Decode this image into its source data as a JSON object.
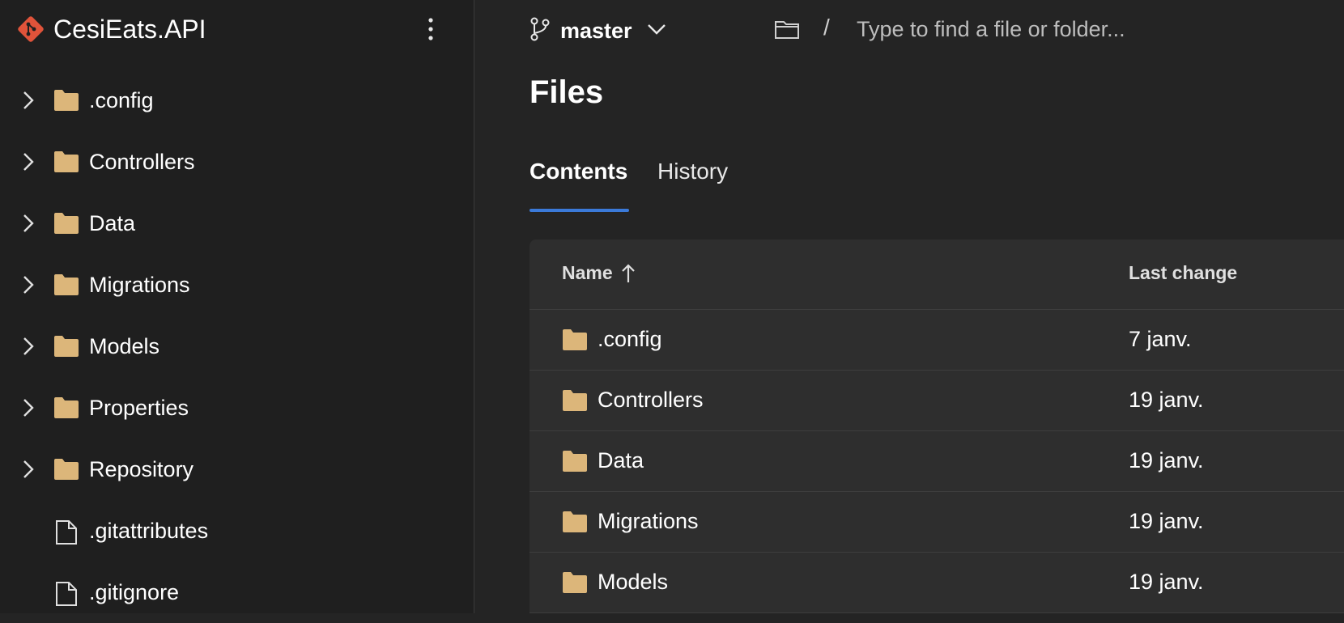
{
  "repo": {
    "name": "CesiEats.API"
  },
  "sidebar": {
    "items": [
      {
        "label": ".config",
        "type": "folder"
      },
      {
        "label": "Controllers",
        "type": "folder"
      },
      {
        "label": "Data",
        "type": "folder"
      },
      {
        "label": "Migrations",
        "type": "folder"
      },
      {
        "label": "Models",
        "type": "folder"
      },
      {
        "label": "Properties",
        "type": "folder"
      },
      {
        "label": "Repository",
        "type": "folder"
      },
      {
        "label": ".gitattributes",
        "type": "file"
      },
      {
        "label": ".gitignore",
        "type": "file"
      }
    ]
  },
  "topbar": {
    "branch": "master",
    "path_separator": "/",
    "search_placeholder": "Type to find a file or folder..."
  },
  "page": {
    "title": "Files"
  },
  "tabs": [
    {
      "label": "Contents"
    },
    {
      "label": "History"
    }
  ],
  "table": {
    "columns": {
      "name": "Name",
      "last_change": "Last change"
    },
    "rows": [
      {
        "name": ".config",
        "date": "7 janv.",
        "icon": "folder-icon"
      },
      {
        "name": "Controllers",
        "date": "19 janv.",
        "icon": "folder-icon"
      },
      {
        "name": "Data",
        "date": "19 janv.",
        "icon": "folder-icon"
      },
      {
        "name": "Migrations",
        "date": "19 janv.",
        "icon": "folder-icon"
      },
      {
        "name": "Models",
        "date": "19 janv.",
        "icon": "folder-icon"
      }
    ]
  },
  "colors": {
    "accent": "#3b7ad9",
    "folder": "#dcb67a",
    "git_logo": "#e0533a",
    "background": "#242424",
    "sidebar": "#1f1f1f",
    "table": "#2e2e2e"
  }
}
